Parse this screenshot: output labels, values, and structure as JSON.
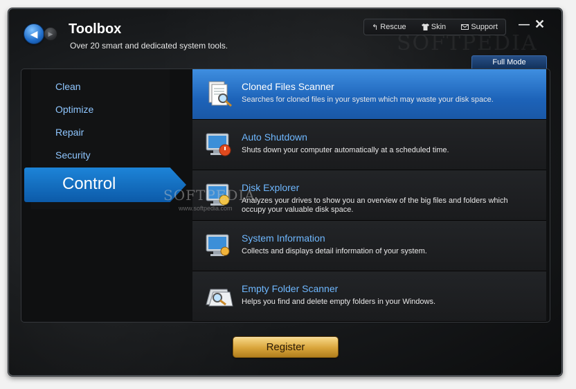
{
  "header": {
    "title": "Toolbox",
    "subtitle": "Over 20 smart and dedicated system tools.",
    "links": [
      {
        "label": "Rescue",
        "icon": "rescue-arrow-icon"
      },
      {
        "label": "Skin",
        "icon": "shirt-icon"
      },
      {
        "label": "Support",
        "icon": "mail-icon"
      }
    ],
    "full_mode": "Full Mode"
  },
  "sidebar": {
    "items": [
      "Clean",
      "Optimize",
      "Repair",
      "Security"
    ],
    "active": "Control"
  },
  "tools": [
    {
      "title": "Cloned Files Scanner",
      "desc": "Searches for cloned files in your system which may waste your disk space.",
      "selected": true
    },
    {
      "title": "Auto Shutdown",
      "desc": "Shuts down your computer automatically at a scheduled time.",
      "selected": false
    },
    {
      "title": "Disk Explorer",
      "desc": "Analyzes your drives to show you an overview of the big files and folders which occupy your valuable disk space.",
      "selected": false
    },
    {
      "title": "System Information",
      "desc": "Collects and displays detail information of your system.",
      "selected": false
    },
    {
      "title": "Empty Folder Scanner",
      "desc": "Helps you find and delete empty folders in your Windows.",
      "selected": false
    }
  ],
  "watermark": {
    "text": "SOFTPEDIA",
    "sub": "www.softpedia.com"
  },
  "register_label": "Register",
  "colors": {
    "accent": "#1d74cc",
    "link": "#8fc6ff",
    "gold": "#d8a43a"
  }
}
